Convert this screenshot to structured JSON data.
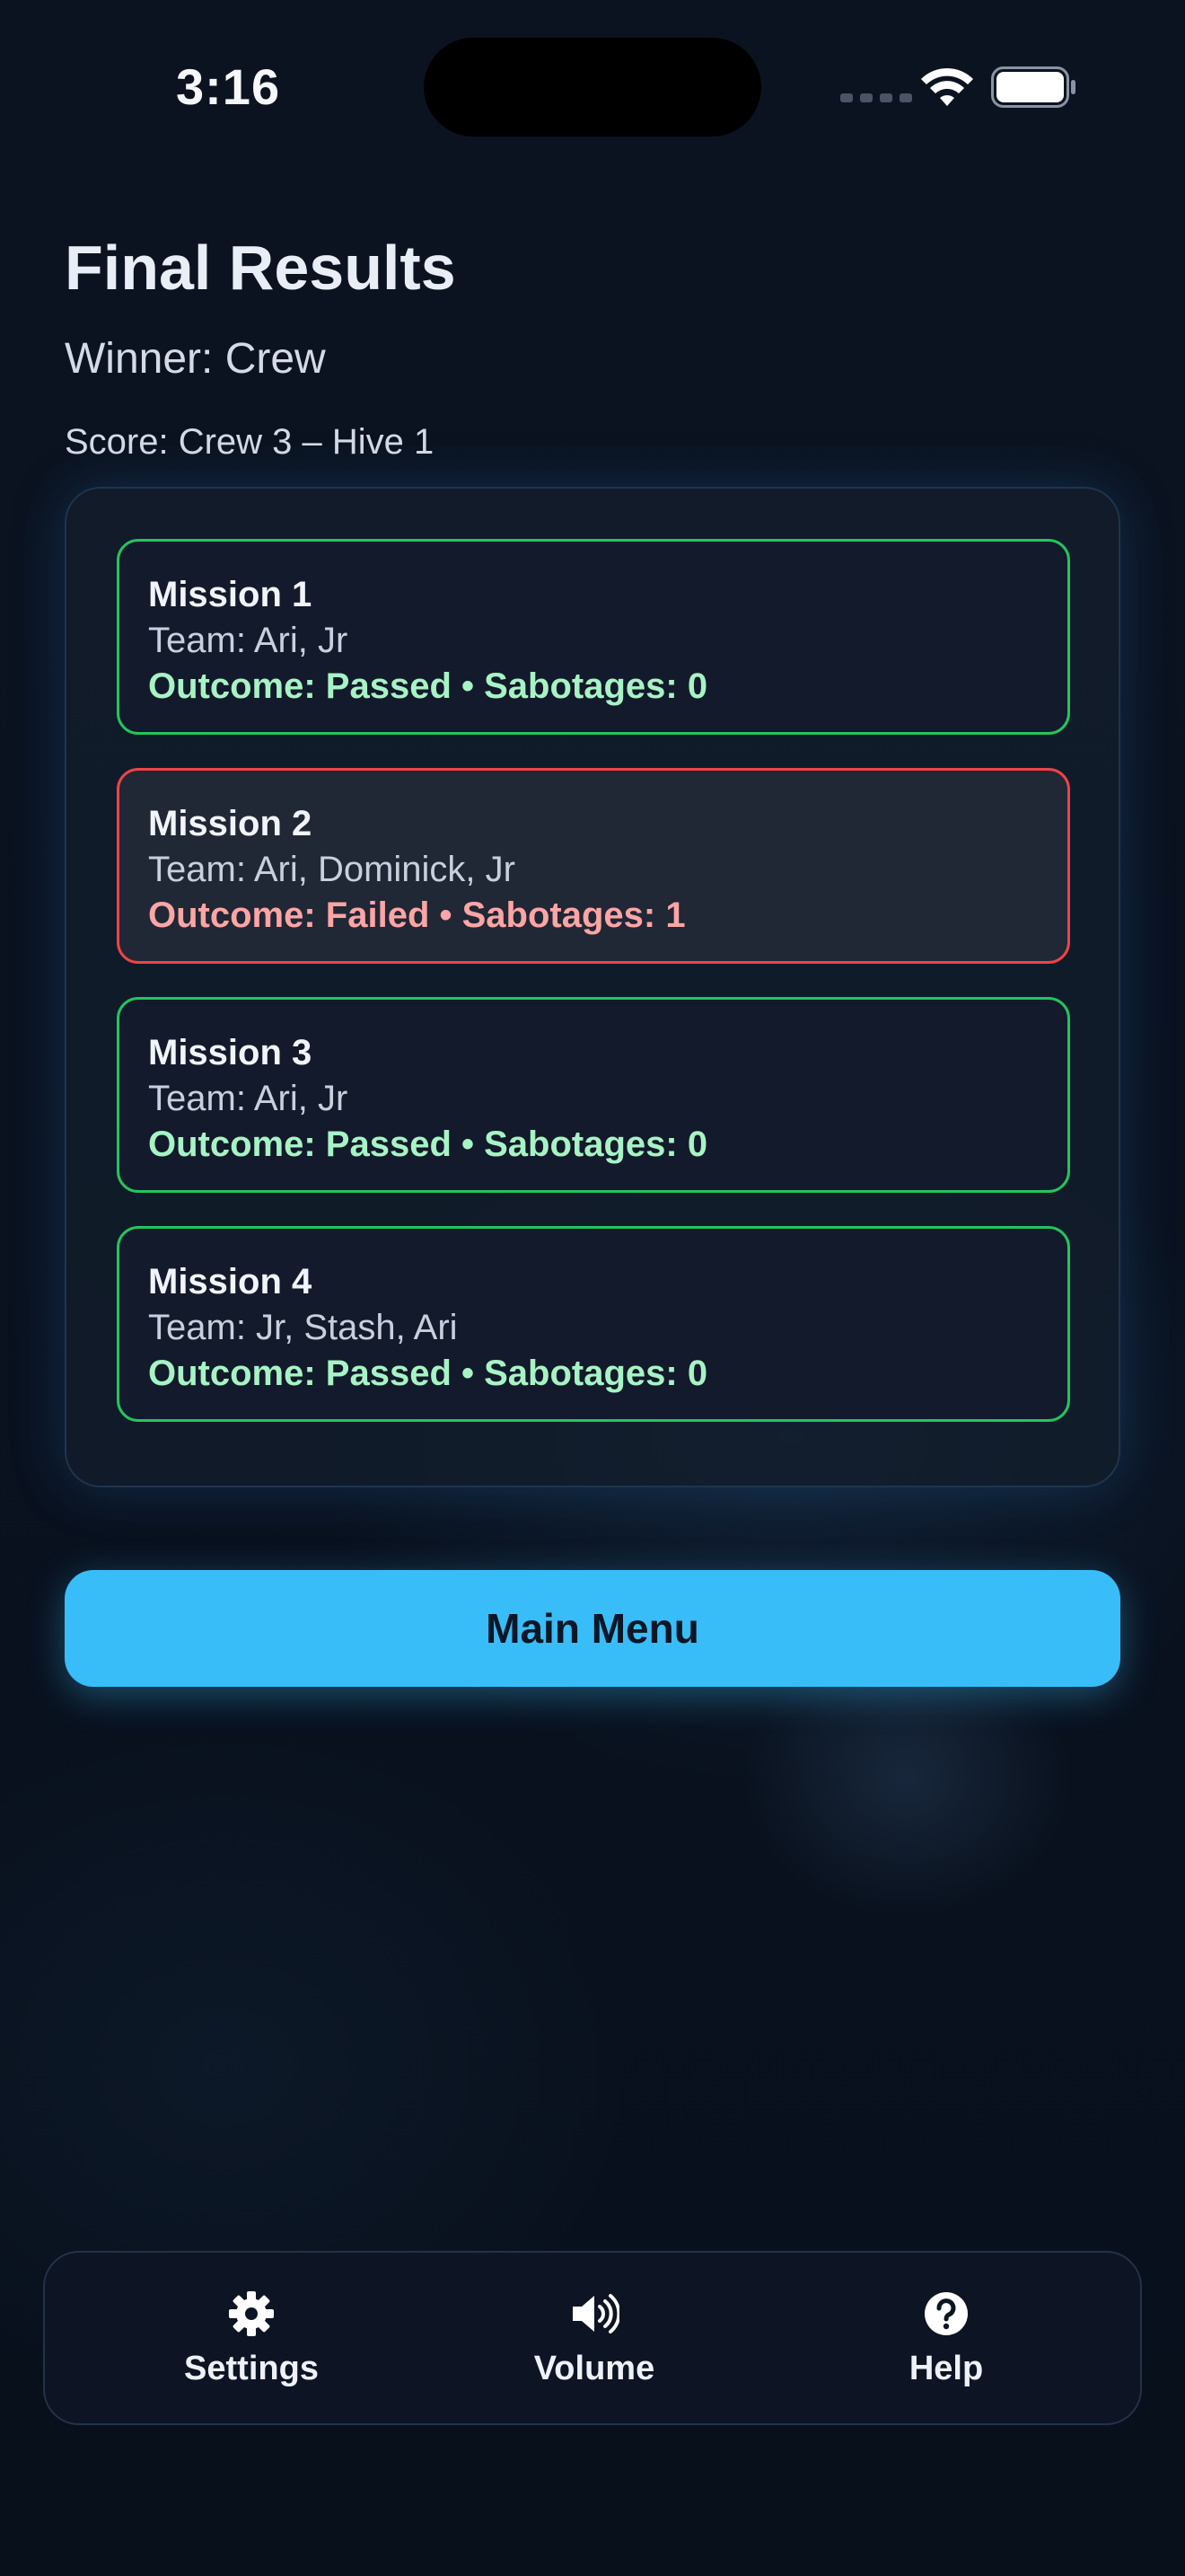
{
  "status_bar": {
    "time": "3:16",
    "icons": [
      "cellular-signal-icon",
      "wifi-icon",
      "battery-icon"
    ]
  },
  "header": {
    "title": "Final Results",
    "winner": "Winner: Crew",
    "score": "Score: Crew 3 – Hive 1"
  },
  "missions": [
    {
      "title": "Mission 1",
      "team": "Team: Ari, Jr",
      "outcome": "Outcome: Passed • Sabotages: 0",
      "status": "passed"
    },
    {
      "title": "Mission 2",
      "team": "Team: Ari, Dominick, Jr",
      "outcome": "Outcome: Failed • Sabotages: 1",
      "status": "failed"
    },
    {
      "title": "Mission 3",
      "team": "Team: Ari, Jr",
      "outcome": "Outcome: Passed • Sabotages: 0",
      "status": "passed"
    },
    {
      "title": "Mission 4",
      "team": "Team: Jr, Stash, Ari",
      "outcome": "Outcome: Passed • Sabotages: 0",
      "status": "passed"
    }
  ],
  "actions": {
    "main_menu_label": "Main Menu"
  },
  "bottom_nav": {
    "items": [
      {
        "label": "Settings",
        "icon": "gear-icon"
      },
      {
        "label": "Volume",
        "icon": "speaker-icon"
      },
      {
        "label": "Help",
        "icon": "question-icon"
      }
    ]
  },
  "colors": {
    "accent": "#38bdf8",
    "passed_border": "#22c55e",
    "passed_text": "#a7f3c5",
    "failed_border": "#ef4444",
    "failed_text": "#fca5a5",
    "background": "#0a1220"
  }
}
